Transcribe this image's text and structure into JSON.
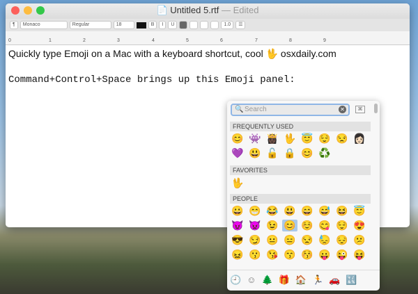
{
  "window": {
    "title": "Untitled 5.rtf",
    "edited": "— Edited"
  },
  "toolbar": {
    "paragraph": "¶",
    "font": "Monaco",
    "style": "Regular",
    "size": "18",
    "bold": "B",
    "italic": "I",
    "underline": "U",
    "spacing": "1.0",
    "list": "☰"
  },
  "ruler": [
    "0",
    "1",
    "2",
    "3",
    "4",
    "5",
    "6",
    "7",
    "8",
    "9"
  ],
  "document": {
    "line1": "Quickly type Emoji on a Mac with a keyboard shortcut, cool 🖖 osxdaily.com",
    "line2": "Command+Control+Space brings up this Emoji panel:"
  },
  "emoji_panel": {
    "search_placeholder": "Search",
    "sections": [
      {
        "title": "FREQUENTLY USED",
        "emoji": [
          "😊",
          "👾",
          "👸🏿",
          "🖖",
          "😇",
          "😌",
          "😒",
          "👩🏻",
          "💜",
          "😃",
          "🔓",
          "🔒",
          "😊",
          "♻️"
        ]
      },
      {
        "title": "FAVORITES",
        "emoji": [
          "🖖"
        ]
      },
      {
        "title": "PEOPLE",
        "emoji": [
          "😀",
          "😁",
          "😂",
          "😃",
          "😄",
          "😅",
          "😆",
          "😇",
          "😈",
          "👿",
          "😉",
          "😊",
          "☺️",
          "😋",
          "😌",
          "😍",
          "😎",
          "😏",
          "😐",
          "😑",
          "😒",
          "😓",
          "😔",
          "😕",
          "😖",
          "😗",
          "😘",
          "😙",
          "😚",
          "😛",
          "😜",
          "😝"
        ]
      }
    ],
    "selected": "😊",
    "categories": [
      "recent",
      "people",
      "nature",
      "objects",
      "places",
      "travel",
      "symbols",
      "flags"
    ],
    "category_icons": [
      "🕘",
      "☺",
      "🌲",
      "🎁",
      "🏠",
      "🏃",
      "🚗",
      "🔣"
    ]
  }
}
